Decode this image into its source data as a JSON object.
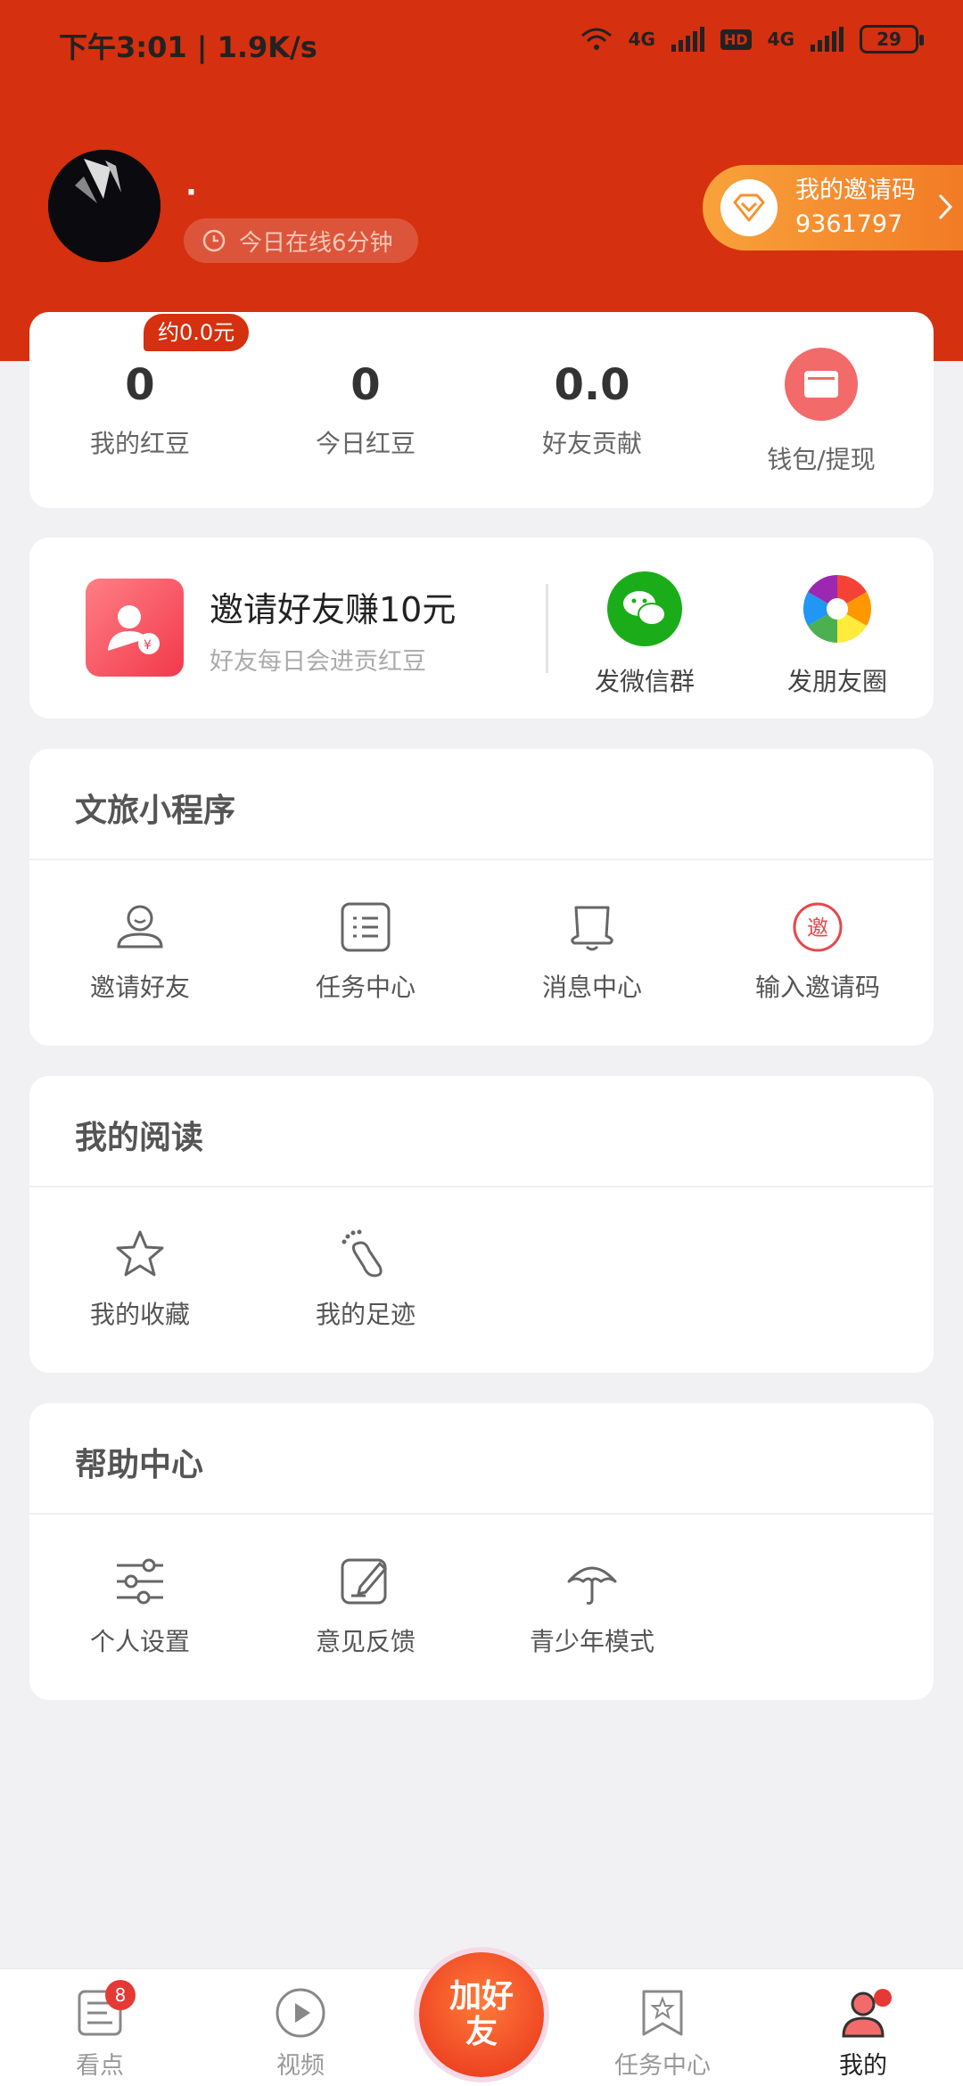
{
  "status_bar": {
    "time": "下午3:01 | 1.9K/s",
    "network1": "4G",
    "hd": "HD",
    "network2": "4G",
    "battery": "29"
  },
  "profile": {
    "username": "·",
    "online_text": "今日在线6分钟"
  },
  "invite_code": {
    "label": "我的邀请码",
    "code": "9361797"
  },
  "stats": {
    "badge": "约0.0元",
    "items": [
      {
        "value": "0",
        "label": "我的红豆"
      },
      {
        "value": "0",
        "label": "今日红豆"
      },
      {
        "value": "0.0",
        "label": "好友贡献"
      }
    ],
    "wallet_label": "钱包/提现"
  },
  "share": {
    "title": "邀请好友赚10元",
    "subtitle": "好友每日会进贡红豆",
    "wechat_group": "发微信群",
    "moments": "发朋友圈"
  },
  "sections": [
    {
      "title": "文旅小程序",
      "items": [
        "邀请好友",
        "任务中心",
        "消息中心",
        "输入邀请码"
      ]
    },
    {
      "title": "我的阅读",
      "items": [
        "我的收藏",
        "我的足迹"
      ]
    },
    {
      "title": "帮助中心",
      "items": [
        "个人设置",
        "意见反馈",
        "青少年模式"
      ]
    }
  ],
  "invite_glyph": "邀",
  "bottom_nav": {
    "items": [
      "看点",
      "视频",
      "任务中心",
      "我的"
    ],
    "badge": "8",
    "center": "加好友"
  },
  "colors": {
    "header": "#d5300f",
    "accent": "#f27a25",
    "active": "#222222"
  }
}
